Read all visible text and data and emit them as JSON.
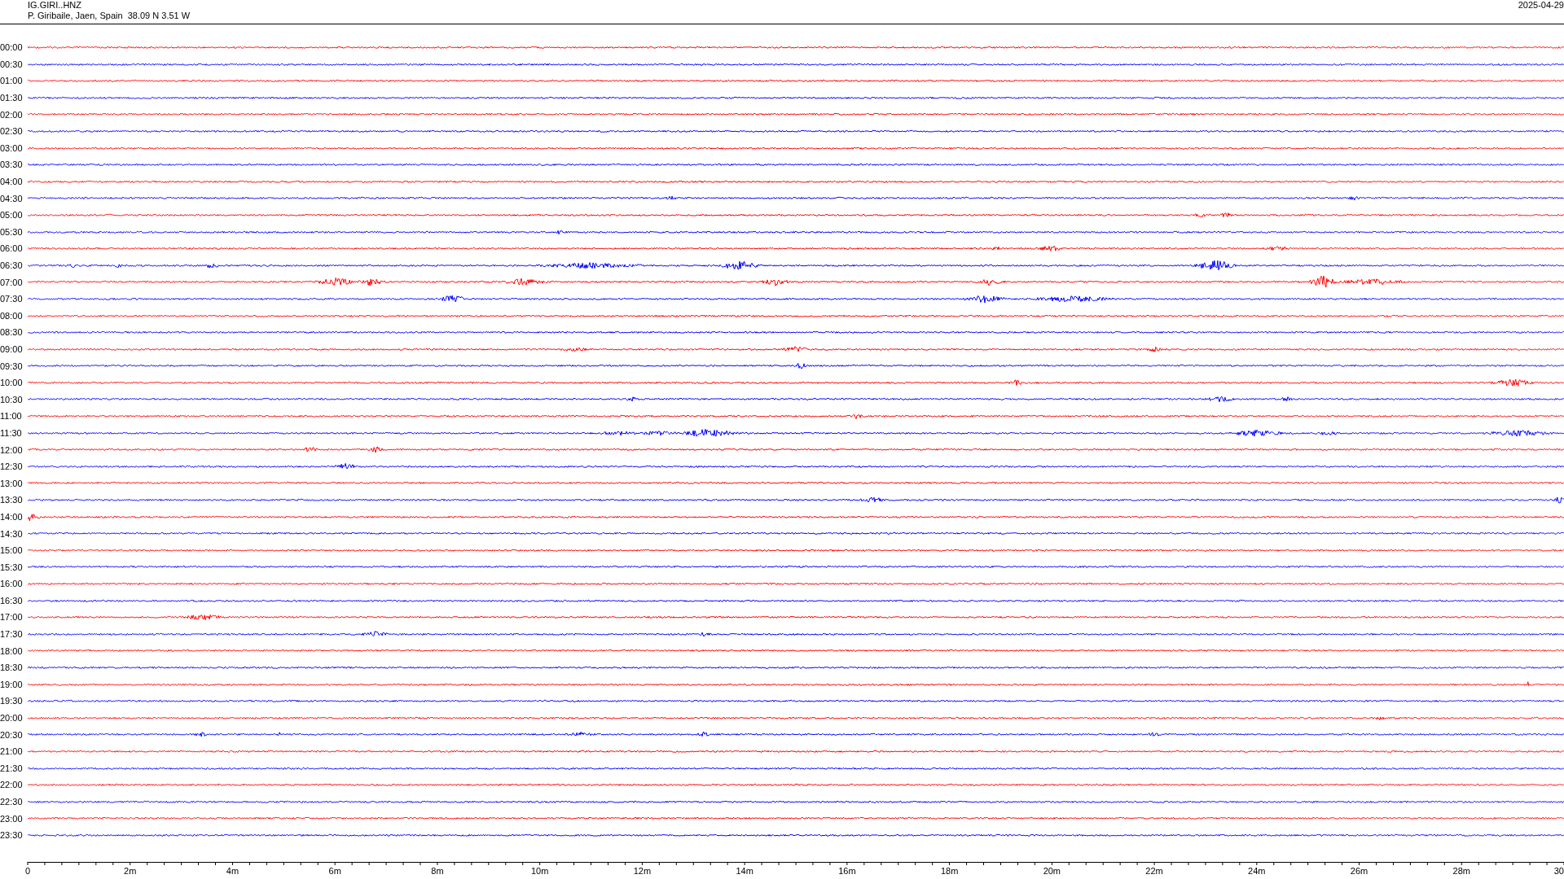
{
  "header": {
    "station": "IG.GIRI..HNZ",
    "location": "P. Giribaile, Jaen, Spain  38.09 N 3.51 W",
    "date": "2025-04-29"
  },
  "traces": [
    {
      "time": "00:00",
      "color": "#ff0000"
    },
    {
      "time": "00:30",
      "color": "#0000ff"
    },
    {
      "time": "01:00",
      "color": "#ff0000"
    },
    {
      "time": "01:30",
      "color": "#0000ff"
    },
    {
      "time": "02:00",
      "color": "#ff0000"
    },
    {
      "time": "02:30",
      "color": "#0000ff"
    },
    {
      "time": "03:00",
      "color": "#ff0000"
    },
    {
      "time": "03:30",
      "color": "#0000ff"
    },
    {
      "time": "04:00",
      "color": "#ff0000"
    },
    {
      "time": "04:30",
      "color": "#0000ff"
    },
    {
      "time": "05:00",
      "color": "#ff0000"
    },
    {
      "time": "05:30",
      "color": "#0000ff"
    },
    {
      "time": "06:00",
      "color": "#ff0000"
    },
    {
      "time": "06:30",
      "color": "#0000ff"
    },
    {
      "time": "07:00",
      "color": "#ff0000"
    },
    {
      "time": "07:30",
      "color": "#0000ff"
    },
    {
      "time": "08:00",
      "color": "#ff0000"
    },
    {
      "time": "08:30",
      "color": "#0000ff"
    },
    {
      "time": "09:00",
      "color": "#ff0000"
    },
    {
      "time": "09:30",
      "color": "#0000ff"
    },
    {
      "time": "10:00",
      "color": "#ff0000"
    },
    {
      "time": "10:30",
      "color": "#0000ff"
    },
    {
      "time": "11:00",
      "color": "#ff0000"
    },
    {
      "time": "11:30",
      "color": "#0000ff"
    },
    {
      "time": "12:00",
      "color": "#ff0000"
    },
    {
      "time": "12:30",
      "color": "#0000ff"
    },
    {
      "time": "13:00",
      "color": "#ff0000"
    },
    {
      "time": "13:30",
      "color": "#0000ff"
    },
    {
      "time": "14:00",
      "color": "#ff0000"
    },
    {
      "time": "14:30",
      "color": "#0000ff"
    },
    {
      "time": "15:00",
      "color": "#ff0000"
    },
    {
      "time": "15:30",
      "color": "#0000ff"
    },
    {
      "time": "16:00",
      "color": "#ff0000"
    },
    {
      "time": "16:30",
      "color": "#0000ff"
    },
    {
      "time": "17:00",
      "color": "#ff0000"
    },
    {
      "time": "17:30",
      "color": "#0000ff"
    },
    {
      "time": "18:00",
      "color": "#ff0000"
    },
    {
      "time": "18:30",
      "color": "#0000ff"
    },
    {
      "time": "19:00",
      "color": "#ff0000"
    },
    {
      "time": "19:30",
      "color": "#0000ff"
    },
    {
      "time": "20:00",
      "color": "#ff0000"
    },
    {
      "time": "20:30",
      "color": "#0000ff"
    },
    {
      "time": "21:00",
      "color": "#ff0000"
    },
    {
      "time": "21:30",
      "color": "#0000ff"
    },
    {
      "time": "22:00",
      "color": "#ff0000"
    },
    {
      "time": "22:30",
      "color": "#0000ff"
    },
    {
      "time": "23:00",
      "color": "#ff0000"
    },
    {
      "time": "23:30",
      "color": "#0000ff"
    }
  ],
  "x_axis": {
    "ticks": [
      "0",
      "2m",
      "4m",
      "6m",
      "8m",
      "10m",
      "12m",
      "14m",
      "16m",
      "18m",
      "20m",
      "22m",
      "24m",
      "26m",
      "28m",
      "30"
    ]
  }
}
